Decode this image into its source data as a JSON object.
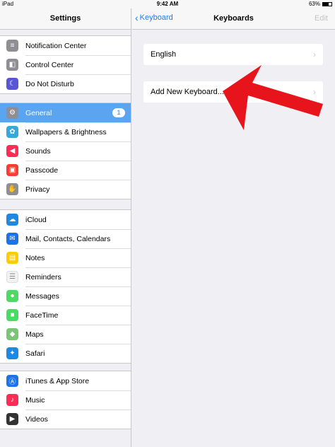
{
  "status": {
    "device": "iPad",
    "time": "9:42 AM",
    "battery": "63%",
    "battery_level": 0.63
  },
  "sidebar": {
    "title": "Settings",
    "groups": [
      [
        {
          "label": "Notification Center",
          "icon": "notification-center-icon",
          "color": "#8e8e93"
        },
        {
          "label": "Control Center",
          "icon": "control-center-icon",
          "color": "#8e8e93"
        },
        {
          "label": "Do Not Disturb",
          "icon": "moon-icon",
          "color": "#5856d6"
        }
      ],
      [
        {
          "label": "General",
          "icon": "gear-icon",
          "color": "#8e8e93",
          "selected": true,
          "badge": "1"
        },
        {
          "label": "Wallpapers & Brightness",
          "icon": "wallpaper-icon",
          "color": "#34aadc"
        },
        {
          "label": "Sounds",
          "icon": "speaker-icon",
          "color": "#ff2d55"
        },
        {
          "label": "Passcode",
          "icon": "lock-icon",
          "color": "#ff3b30"
        },
        {
          "label": "Privacy",
          "icon": "hand-icon",
          "color": "#8e8e93"
        }
      ],
      [
        {
          "label": "iCloud",
          "icon": "cloud-icon",
          "color": "#1e88e5"
        },
        {
          "label": "Mail, Contacts, Calendars",
          "icon": "mail-icon",
          "color": "#1a73e8"
        },
        {
          "label": "Notes",
          "icon": "notes-icon",
          "color": "#ffcc00"
        },
        {
          "label": "Reminders",
          "icon": "reminders-icon",
          "color": "#f2f2f2"
        },
        {
          "label": "Messages",
          "icon": "messages-icon",
          "color": "#4cd964"
        },
        {
          "label": "FaceTime",
          "icon": "facetime-icon",
          "color": "#4cd964"
        },
        {
          "label": "Maps",
          "icon": "maps-icon",
          "color": "#7cc576"
        },
        {
          "label": "Safari",
          "icon": "safari-icon",
          "color": "#1e88e5"
        }
      ],
      [
        {
          "label": "iTunes & App Store",
          "icon": "app-store-icon",
          "color": "#1a73e8"
        },
        {
          "label": "Music",
          "icon": "music-icon",
          "color": "#ff2d55"
        },
        {
          "label": "Videos",
          "icon": "videos-icon",
          "color": "#333333"
        }
      ]
    ]
  },
  "detail": {
    "back_label": "Keyboard",
    "title": "Keyboards",
    "edit_label": "Edit",
    "items": [
      "English",
      "Add New Keyboard..."
    ]
  },
  "colors": {
    "accent": "#147efb",
    "selected": "#5aa4f0",
    "annotation_arrow": "#e8141b"
  }
}
